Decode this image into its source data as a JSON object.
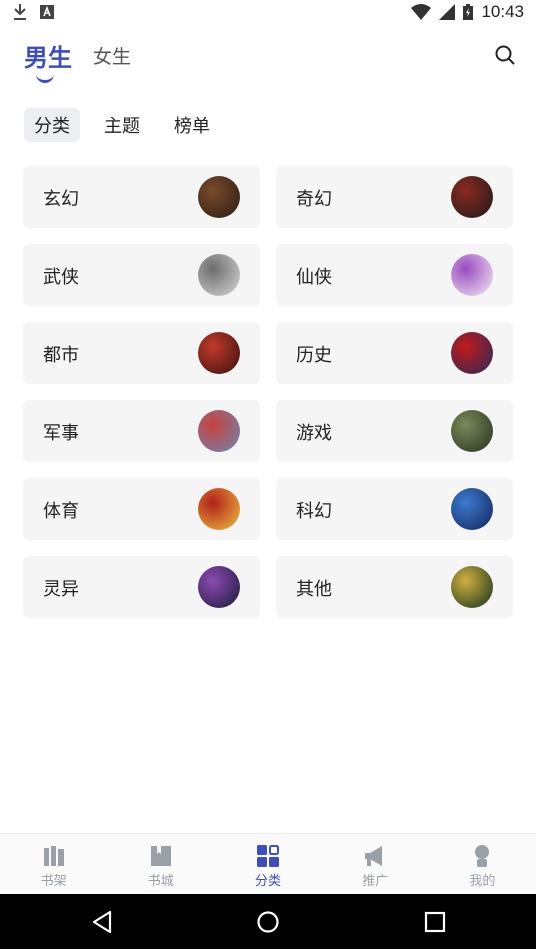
{
  "status_bar": {
    "time": "10:43",
    "icons": [
      "download-icon",
      "font-icon",
      "wifi-icon",
      "cell-signal-icon",
      "battery-icon"
    ]
  },
  "header": {
    "tabs": [
      {
        "label": "男生",
        "active": true
      },
      {
        "label": "女生",
        "active": false
      }
    ],
    "search_icon": "search-icon"
  },
  "subtabs": [
    {
      "label": "分类",
      "active": true
    },
    {
      "label": "主题",
      "active": false
    },
    {
      "label": "榜单",
      "active": false
    }
  ],
  "categories": [
    {
      "label": "玄幻",
      "cover_colors": [
        "#2a1d15",
        "#7a4a2a"
      ]
    },
    {
      "label": "奇幻",
      "cover_colors": [
        "#1d1a1a",
        "#8a2a20"
      ]
    },
    {
      "label": "武侠",
      "cover_colors": [
        "#d8d8d8",
        "#6c6c6c"
      ]
    },
    {
      "label": "仙侠",
      "cover_colors": [
        "#f3eef4",
        "#9a4ac0"
      ]
    },
    {
      "label": "都市",
      "cover_colors": [
        "#3a1010",
        "#c03a2a"
      ]
    },
    {
      "label": "历史",
      "cover_colors": [
        "#2a2a5a",
        "#c01a1a"
      ]
    },
    {
      "label": "军事",
      "cover_colors": [
        "#6d88b0",
        "#c84040"
      ]
    },
    {
      "label": "游戏",
      "cover_colors": [
        "#26301f",
        "#7a8a5a"
      ]
    },
    {
      "label": "体育",
      "cover_colors": [
        "#f0c040",
        "#b0201a"
      ]
    },
    {
      "label": "科幻",
      "cover_colors": [
        "#12245a",
        "#3c7ad0"
      ]
    },
    {
      "label": "灵异",
      "cover_colors": [
        "#1e1a3a",
        "#8a4ab0"
      ]
    },
    {
      "label": "其他",
      "cover_colors": [
        "#12301e",
        "#d0b040"
      ]
    }
  ],
  "bottom_nav": [
    {
      "label": "书架",
      "icon": "bookshelf-icon",
      "active": false
    },
    {
      "label": "书城",
      "icon": "book-icon",
      "active": false
    },
    {
      "label": "分类",
      "icon": "category-grid-icon",
      "active": true
    },
    {
      "label": "推广",
      "icon": "megaphone-icon",
      "active": false
    },
    {
      "label": "我的",
      "icon": "user-icon",
      "active": false
    }
  ],
  "system_nav": [
    "back-icon",
    "home-icon",
    "recents-icon"
  ],
  "colors": {
    "accent": "#3d4fb5",
    "card_bg": "#f5f5f6"
  }
}
